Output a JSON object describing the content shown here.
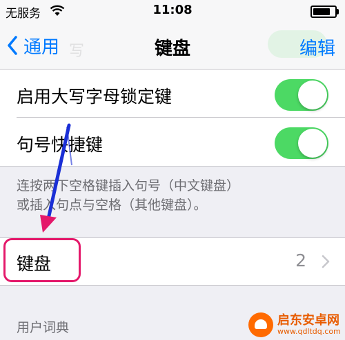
{
  "status_bar": {
    "carrier": "无服务",
    "time": "11:08",
    "battery_level": 0.85
  },
  "nav": {
    "back_label": "通用",
    "title": "键盘",
    "edit_label": "编辑",
    "ghost_text": "写"
  },
  "settings": {
    "caps_lock": {
      "label": "启用大写字母锁定键",
      "enabled": true
    },
    "period_shortcut": {
      "label": "句号快捷键",
      "enabled": true
    },
    "footer": {
      "line1": "连按两下空格键插入句号（中文键盘）",
      "line2": "或插入句点与空格（其他键盘）。"
    }
  },
  "keyboards": {
    "label": "键盘",
    "count": "2"
  },
  "user_dictionary_header": "用户词典",
  "watermark": {
    "name": "启东安卓网",
    "url": "www.qdltdq.com"
  },
  "colors": {
    "accent": "#007aff",
    "toggle_on": "#4cd964",
    "highlight": "#e4186a",
    "arrow": "#1a2fd6"
  }
}
